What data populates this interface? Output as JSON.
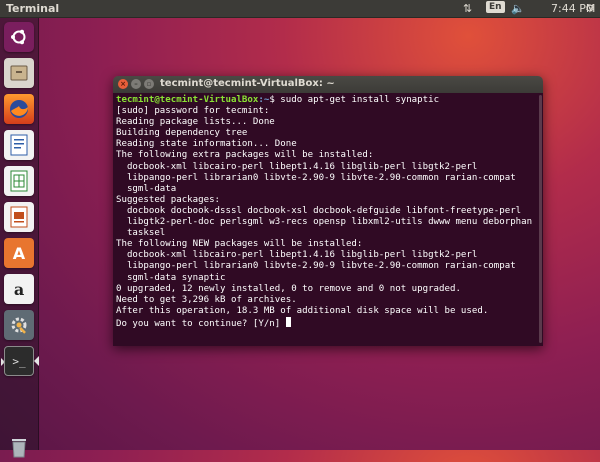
{
  "top_panel": {
    "title": "Terminal",
    "language": "En",
    "time": "7:44 PM"
  },
  "launcher": {
    "items": [
      {
        "name": "dash",
        "icon": "ubuntu-logo-icon"
      },
      {
        "name": "files",
        "icon": "file-cabinet-icon"
      },
      {
        "name": "firefox",
        "icon": "firefox-icon"
      },
      {
        "name": "writer",
        "icon": "document-icon"
      },
      {
        "name": "calc",
        "icon": "spreadsheet-icon"
      },
      {
        "name": "impress",
        "icon": "presentation-icon"
      },
      {
        "name": "software-center",
        "icon": "shopping-bag-icon",
        "glyph": "A"
      },
      {
        "name": "amazon",
        "icon": "amazon-icon",
        "glyph": "a"
      },
      {
        "name": "system-settings",
        "icon": "gear-wrench-icon"
      },
      {
        "name": "terminal",
        "icon": "terminal-icon",
        "glyph": ">_"
      },
      {
        "name": "trash",
        "icon": "trash-icon"
      }
    ]
  },
  "terminal": {
    "window_title": "tecmint@tecmint-VirtualBox: ~",
    "prompt_user": "tecmint@tecmint-VirtualBox",
    "prompt_path": ":~",
    "prompt_symbol": "$ ",
    "command": "sudo apt-get install synaptic",
    "output": [
      "[sudo] password for tecmint:",
      "Reading package lists... Done",
      "Building dependency tree",
      "Reading state information... Done",
      "The following extra packages will be installed:",
      "  docbook-xml libcairo-perl libept1.4.16 libglib-perl libgtk2-perl",
      "  libpango-perl librarian0 libvte-2.90-9 libvte-2.90-common rarian-compat",
      "  sgml-data",
      "Suggested packages:",
      "  docbook docbook-dsssl docbook-xsl docbook-defguide libfont-freetype-perl",
      "  libgtk2-perl-doc perlsgml w3-recs opensp libxml2-utils dwww menu deborphan",
      "  tasksel",
      "The following NEW packages will be installed:",
      "  docbook-xml libcairo-perl libept1.4.16 libglib-perl libgtk2-perl",
      "  libpango-perl librarian0 libvte-2.90-9 libvte-2.90-common rarian-compat",
      "  sgml-data synaptic",
      "0 upgraded, 12 newly installed, 0 to remove and 0 not upgraded.",
      "Need to get 3,296 kB of archives.",
      "After this operation, 18.3 MB of additional disk space will be used."
    ],
    "final_prompt": "Do you want to continue? [Y/n] "
  },
  "colors": {
    "terminal_bg": "#300a24",
    "prompt_user": "#8ae234",
    "prompt_path": "#729fcf",
    "panel_bg": "#3c3b37"
  }
}
